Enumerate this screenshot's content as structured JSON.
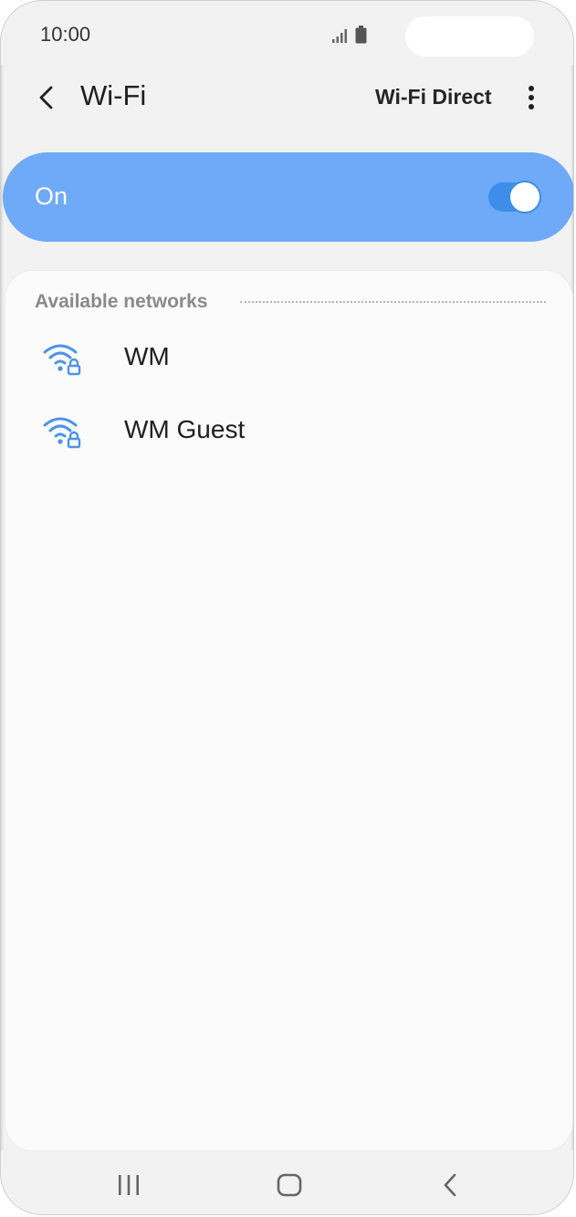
{
  "status_bar": {
    "time": "10:00",
    "icons": [
      "signal-icon",
      "battery-icon"
    ]
  },
  "header": {
    "title": "Wi-Fi",
    "wifi_direct_label": "Wi-Fi Direct",
    "icons": [
      "back-arrow-icon",
      "more-options-icon"
    ]
  },
  "wifi_toggle": {
    "label": "On",
    "state": "on"
  },
  "networks": {
    "section_label": "Available networks",
    "items": [
      {
        "name": "WM",
        "icon": "wifi-secured-icon"
      },
      {
        "name": "WM Guest",
        "icon": "wifi-secured-icon"
      }
    ]
  },
  "nav_bar": {
    "icons": [
      "recent-apps-icon",
      "home-icon",
      "back-icon"
    ]
  },
  "colors": {
    "accent": "#6eaaf8",
    "switch": "#3e8de8",
    "wifi_icon": "#4c93ea",
    "background": "#f2f2f2",
    "card": "#fbfbfb"
  }
}
